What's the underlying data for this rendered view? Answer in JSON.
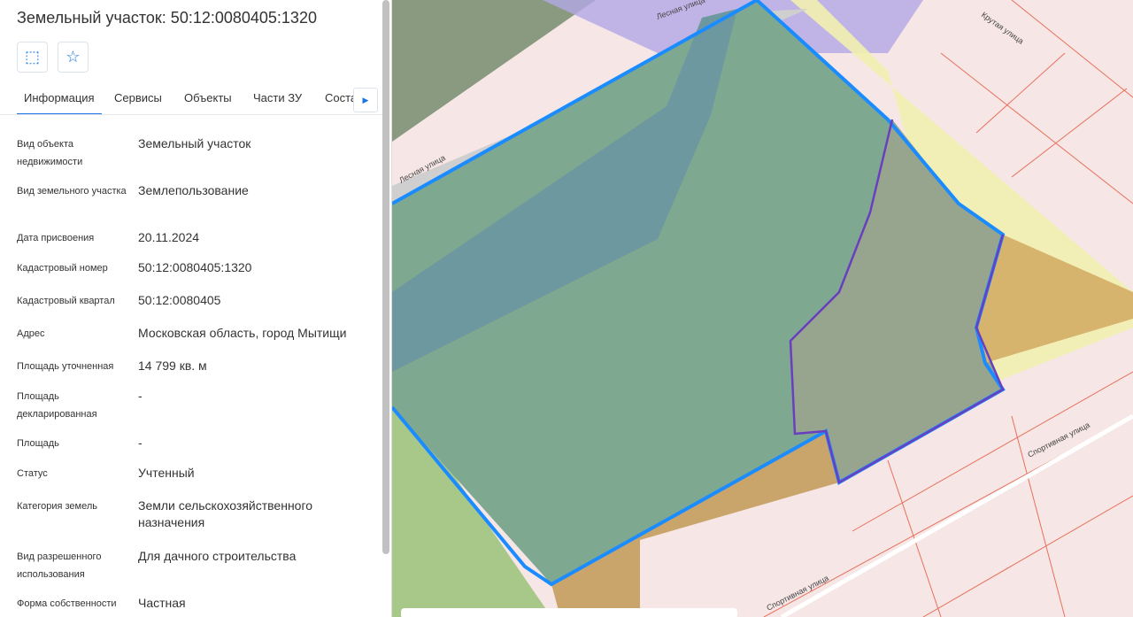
{
  "panel": {
    "title": "Земельный участок: 50:12:0080405:1320",
    "tabs": [
      "Информация",
      "Сервисы",
      "Объекты",
      "Части ЗУ",
      "Соста"
    ],
    "rows": [
      {
        "label": "Вид объекта недвижимости",
        "value": "Земельный участок"
      },
      {
        "label": "Вид земельного участка",
        "value": "Землепользование"
      },
      {
        "label": "Дата присвоения",
        "value": "20.11.2024"
      },
      {
        "label": "Кадастровый номер",
        "value": "50:12:0080405:1320"
      },
      {
        "label": "Кадастровый квартал",
        "value": "50:12:0080405"
      },
      {
        "label": "Адрес",
        "value": "Московская область, город Мытищи"
      },
      {
        "label": "Площадь уточненная",
        "value": "14 799 кв. м"
      },
      {
        "label": "Площадь декларированная",
        "value": "-"
      },
      {
        "label": "Площадь",
        "value": "-"
      },
      {
        "label": "Статус",
        "value": "Учтенный"
      },
      {
        "label": "Категория земель",
        "value": "Земли сельскохозяйственного назначения"
      },
      {
        "label": "Вид разрешенного использования",
        "value": "Для дачного строительства"
      },
      {
        "label": "Форма собственности",
        "value": "Частная"
      }
    ]
  },
  "map": {
    "streets": [
      "Лесная улица",
      "Лесная улица",
      "Крутая улица",
      "Спортивная улица",
      "Спортивная улица"
    ],
    "colors": {
      "selected_border": "#1a8cff",
      "parcel_border": "#e8705a",
      "zone_purple": "#6a3fbf"
    }
  }
}
